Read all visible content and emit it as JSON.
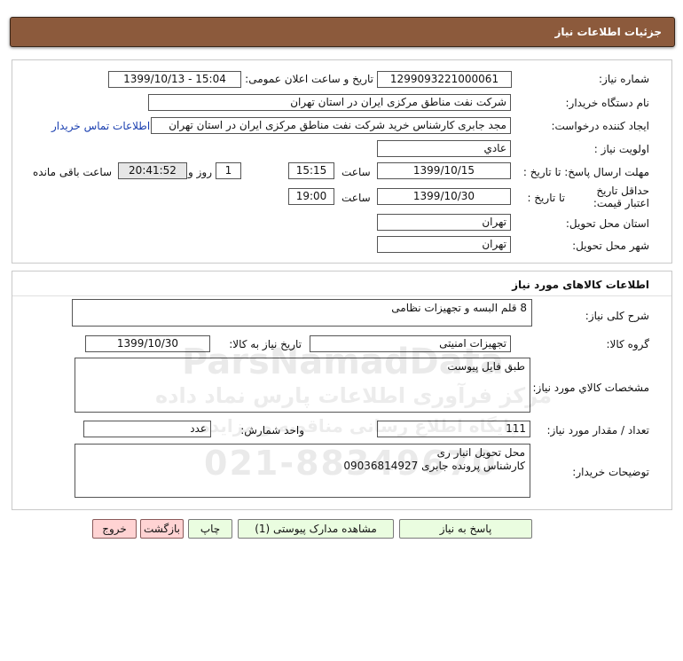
{
  "header": {
    "title": "جزئیات اطلاعات نیاز"
  },
  "info": {
    "need_number_label": "شماره نیاز:",
    "need_number": "1299093221000061",
    "announce_label": "تاریخ و ساعت اعلان عمومی:",
    "announce_value": "1399/10/13 - 15:04",
    "buyer_org_label": "نام دستگاه خریدار:",
    "buyer_org": "شرکت نفت مناطق مرکزی ایران در استان تهران",
    "requester_label": "ایجاد کننده درخواست:",
    "requester": "مجد جابری کارشناس خرید شرکت نفت مناطق مرکزی ایران در استان تهران",
    "contact_link": "اطلاعات تماس خریدار",
    "priority_label": "اولویت نیاز :",
    "priority": "عادي",
    "deadline_label": "مهلت ارسال پاسخ: تا تاریخ :",
    "deadline_date": "1399/10/15",
    "time_label": "ساعت",
    "deadline_time": "15:15",
    "days_value": "1",
    "days_label": "روز و",
    "remaining_time": "20:41:52",
    "remaining_label": "ساعت باقی مانده",
    "validity_label": "حداقل تاریخ اعتبار قیمت:",
    "validity_to_label": "تا تاریخ :",
    "validity_date": "1399/10/30",
    "validity_time_label": "ساعت",
    "validity_time": "19:00",
    "province_label": "استان محل تحویل:",
    "province": "تهران",
    "city_label": "شهر محل تحویل:",
    "city": "تهران"
  },
  "goods": {
    "section_title": "اطلاعات کالاهای مورد نیاز",
    "desc_label": "شرح کلی نیاز:",
    "desc": "8 قلم البسه و تجهیزات نظامی",
    "group_label": "گروه کالا:",
    "group": "تجهیزات امنیتی",
    "need_date_label": "تاریخ نیاز به کالا:",
    "need_date": "1399/10/30",
    "specs_label": "مشخصات کالاي مورد نیاز:",
    "specs": "طبق فایل پیوست",
    "qty_label": "تعداد / مقدار مورد نیاز:",
    "qty": "111",
    "unit_label": "واحد شمارش:",
    "unit": "عدد",
    "buyer_notes_label": "توضیحات خریدار:",
    "buyer_notes_line1": "محل تحویل انبار ری",
    "buyer_notes_line2": "کارشناس پرونده جابری 09036814927"
  },
  "buttons": {
    "reply": "پاسخ به نیاز",
    "attachments": "مشاهده مدارک پیوستی (1)",
    "print": "چاپ",
    "back": "بازگشت",
    "exit": "خروج"
  },
  "watermark": {
    "phone": "021-88349670",
    "brand": "ParsNamadData",
    "fa_line1": "مرکز فرآوری اطلاعات پارس نماد داده",
    "fa_line2": "پایگاه اطلاع رسانی مناقصه و مزایده"
  }
}
